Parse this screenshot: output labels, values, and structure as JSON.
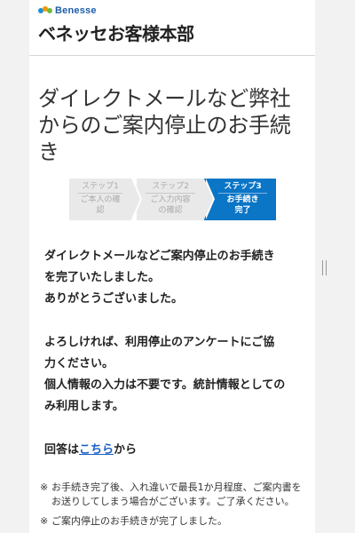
{
  "header": {
    "logo_text": "Benesse",
    "site_title": "ベネッセお客様本部"
  },
  "page_title": "ダイレクトメールなど弊社からのご案内停止のお手続き",
  "steps": [
    {
      "num": "ステップ1",
      "label": "ご本人の確認",
      "state": "done"
    },
    {
      "num": "ステップ2",
      "label": "ご入力内容の確認",
      "state": "done"
    },
    {
      "num": "ステップ3",
      "label": "お手続き完了",
      "state": "current"
    }
  ],
  "content": {
    "para1_line1": "ダイレクトメールなどご案内停止のお手続き",
    "para1_line2": "を完了いたしました。",
    "para1_line3": "ありがとうございました。",
    "para2_line1": "よろしければ、利用停止のアンケートにご協",
    "para2_line2": "力ください。",
    "para2_line3": "個人情報の入力は不要です。統計情報としての",
    "para2_line4": "み利用します。",
    "answer_prefix": "回答は",
    "answer_link": "こちら",
    "answer_suffix": "から"
  },
  "notes": [
    {
      "mark": "※",
      "text": "お手続き完了後、入れ違いで最長1か月程度、ご案内書をお送りしてしまう場合がございます。ご了承ください。"
    },
    {
      "mark": "※",
      "text": "ご案内停止のお手続きが完了しました。"
    }
  ],
  "colors": {
    "accent": "#0b75c6",
    "link": "#1a5fc4",
    "step_inactive": "#e9e9e9"
  }
}
